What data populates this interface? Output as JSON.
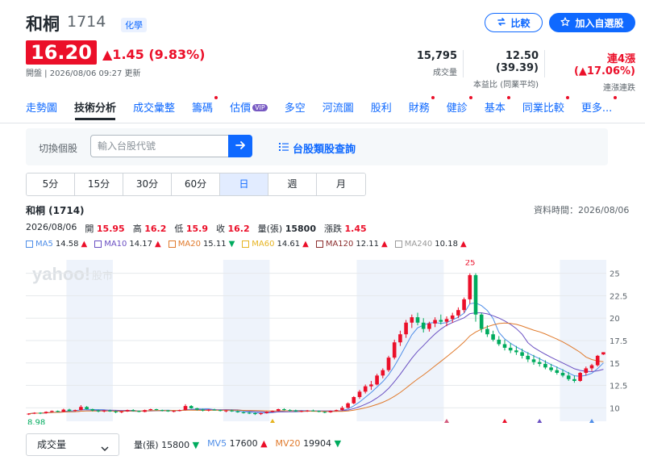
{
  "header": {
    "name": "和桐",
    "code": "1714",
    "sector": "化學",
    "compare_label": "比較",
    "watchlist_label": "加入自選股"
  },
  "quote": {
    "price": "16.20",
    "change": "▲1.45 (9.83%)",
    "market_time": "開盤 | 2026/08/06 09:27 更新"
  },
  "stats": [
    {
      "value": "15,795",
      "label": "成交量"
    },
    {
      "value": "12.50 (39.39)",
      "label": "本益比 (同業平均)"
    },
    {
      "value": "連4漲 (▲17.06%)",
      "label": "連漲連跌"
    }
  ],
  "tabs": [
    {
      "label": "走勢圖",
      "dot": false
    },
    {
      "label": "技術分析",
      "dot": false,
      "active": true
    },
    {
      "label": "成交彙整",
      "dot": false
    },
    {
      "label": "籌碼",
      "dot": true
    },
    {
      "label": "估價",
      "dot": false,
      "vip": "VIP"
    },
    {
      "label": "多空",
      "dot": false
    },
    {
      "label": "河流圖",
      "dot": false
    },
    {
      "label": "股利",
      "dot": false
    },
    {
      "label": "財務",
      "dot": true
    },
    {
      "label": "健診",
      "dot": true
    },
    {
      "label": "基本",
      "dot": true
    },
    {
      "label": "同業比較",
      "dot": true
    },
    {
      "label": "更多...",
      "dot": true
    }
  ],
  "switcher": {
    "label": "切換個股",
    "placeholder": "輸入台股代號",
    "category_link": "台股類股查詢"
  },
  "periods": [
    "5分",
    "15分",
    "30分",
    "60分",
    "日",
    "週",
    "月"
  ],
  "active_period": "日",
  "chart_header": {
    "title": "和桐 (1714)",
    "data_time": "資料時間：2026/08/06",
    "date": "2026/08/06",
    "open_label": "開",
    "open": "15.95",
    "high_label": "高",
    "high": "16.2",
    "low_label": "低",
    "low": "15.9",
    "close_label": "收",
    "close": "16.2",
    "vol_label": "量(張)",
    "vol": "15800",
    "chg_label": "漲跌",
    "chg": "1.45"
  },
  "ma_legend": [
    {
      "label": "MA5",
      "value": "14.58",
      "dir": "▲",
      "color": "#4f8ee8"
    },
    {
      "label": "MA10",
      "value": "14.17",
      "dir": "▲",
      "color": "#6a4fc2"
    },
    {
      "label": "MA20",
      "value": "15.11",
      "dir": "▼",
      "color": "#e07a2c"
    },
    {
      "label": "MA60",
      "value": "14.61",
      "dir": "▲",
      "color": "#e6b422"
    },
    {
      "label": "MA120",
      "value": "12.11",
      "dir": "▲",
      "color": "#8b2d2d"
    },
    {
      "label": "MA240",
      "value": "10.18",
      "dir": "▲",
      "color": "#9a9a9a"
    }
  ],
  "chart_data": {
    "type": "candlestick",
    "y_ticks": [
      "25",
      "22.5",
      "20",
      "17.5",
      "15",
      "12.5",
      "10"
    ],
    "ylim": [
      8.5,
      26.5
    ],
    "min_label": "8.98",
    "max_label": "25",
    "candles": [
      [
        9.3,
        9.4,
        9.2,
        9.35
      ],
      [
        9.35,
        9.5,
        9.3,
        9.45
      ],
      [
        9.45,
        9.5,
        9.3,
        9.4
      ],
      [
        9.4,
        9.6,
        9.35,
        9.55
      ],
      [
        9.55,
        9.7,
        9.5,
        9.65
      ],
      [
        9.65,
        9.7,
        9.5,
        9.55
      ],
      [
        9.55,
        9.9,
        9.5,
        9.8
      ],
      [
        9.8,
        9.9,
        9.6,
        9.65
      ],
      [
        9.65,
        9.8,
        9.6,
        9.75
      ],
      [
        9.75,
        10.3,
        9.7,
        10.1
      ],
      [
        10.1,
        10.2,
        9.8,
        9.85
      ],
      [
        9.85,
        9.9,
        9.6,
        9.7
      ],
      [
        9.7,
        9.8,
        9.5,
        9.6
      ],
      [
        9.6,
        9.75,
        9.5,
        9.7
      ],
      [
        9.7,
        9.8,
        9.55,
        9.6
      ],
      [
        9.6,
        9.7,
        9.4,
        9.5
      ],
      [
        9.5,
        9.65,
        9.4,
        9.6
      ],
      [
        9.6,
        9.8,
        9.55,
        9.75
      ],
      [
        9.75,
        9.85,
        9.6,
        9.65
      ],
      [
        9.65,
        9.7,
        9.5,
        9.55
      ],
      [
        9.55,
        9.8,
        9.5,
        9.75
      ],
      [
        9.75,
        9.9,
        9.7,
        9.85
      ],
      [
        9.85,
        9.9,
        9.7,
        9.75
      ],
      [
        9.75,
        9.8,
        9.6,
        9.7
      ],
      [
        9.7,
        9.75,
        9.55,
        9.6
      ],
      [
        9.6,
        9.7,
        9.5,
        9.65
      ],
      [
        9.65,
        9.8,
        9.6,
        9.75
      ],
      [
        9.75,
        10.4,
        9.7,
        10.2
      ],
      [
        10.2,
        10.3,
        9.9,
        9.95
      ],
      [
        9.95,
        10.0,
        9.7,
        9.8
      ],
      [
        9.8,
        9.9,
        9.6,
        9.7
      ],
      [
        9.7,
        9.85,
        9.6,
        9.8
      ],
      [
        9.8,
        9.9,
        9.7,
        9.75
      ],
      [
        9.75,
        9.8,
        9.6,
        9.65
      ],
      [
        9.65,
        9.75,
        9.5,
        9.7
      ],
      [
        9.7,
        9.8,
        9.55,
        9.6
      ],
      [
        9.6,
        9.7,
        9.45,
        9.5
      ],
      [
        9.5,
        9.6,
        9.35,
        9.45
      ],
      [
        9.45,
        9.55,
        9.3,
        9.4
      ],
      [
        9.4,
        9.5,
        9.2,
        9.3
      ],
      [
        9.3,
        9.45,
        9.2,
        9.4
      ],
      [
        9.4,
        9.6,
        9.35,
        9.55
      ],
      [
        9.55,
        9.7,
        9.5,
        9.65
      ],
      [
        9.65,
        9.9,
        9.6,
        9.85
      ],
      [
        9.85,
        9.95,
        9.7,
        9.75
      ],
      [
        9.75,
        9.85,
        9.6,
        9.7
      ],
      [
        9.7,
        9.8,
        9.55,
        9.6
      ],
      [
        9.6,
        9.7,
        9.5,
        9.65
      ],
      [
        9.65,
        9.75,
        9.55,
        9.7
      ],
      [
        9.7,
        9.8,
        9.6,
        9.65
      ],
      [
        9.65,
        9.7,
        9.5,
        9.55
      ],
      [
        9.55,
        9.6,
        9.4,
        9.5
      ],
      [
        9.5,
        9.7,
        9.45,
        9.65
      ],
      [
        9.65,
        9.8,
        9.6,
        9.75
      ],
      [
        9.75,
        10.2,
        9.7,
        10.0
      ],
      [
        10.0,
        10.6,
        9.95,
        10.5
      ],
      [
        10.5,
        11.3,
        10.4,
        11.2
      ],
      [
        11.2,
        12.0,
        11.0,
        11.8
      ],
      [
        11.8,
        12.6,
        11.6,
        12.4
      ],
      [
        12.4,
        13.0,
        12.0,
        12.6
      ],
      [
        12.6,
        13.8,
        12.5,
        13.6
      ],
      [
        13.6,
        14.4,
        13.3,
        14.2
      ],
      [
        14.2,
        15.8,
        14.0,
        15.6
      ],
      [
        15.6,
        17.6,
        15.4,
        17.3
      ],
      [
        17.3,
        18.6,
        16.9,
        18.2
      ],
      [
        18.2,
        19.8,
        17.8,
        19.5
      ],
      [
        19.5,
        20.4,
        18.9,
        20.1
      ],
      [
        20.1,
        20.6,
        19.2,
        19.5
      ],
      [
        19.5,
        20.0,
        18.4,
        18.8
      ],
      [
        18.8,
        19.6,
        18.5,
        19.4
      ],
      [
        19.4,
        20.1,
        19.0,
        19.8
      ],
      [
        19.8,
        20.4,
        19.3,
        19.6
      ],
      [
        19.6,
        20.2,
        19.1,
        19.9
      ],
      [
        19.9,
        20.6,
        19.5,
        20.3
      ],
      [
        20.3,
        21.2,
        20.0,
        20.9
      ],
      [
        20.9,
        22.3,
        20.6,
        22.1
      ],
      [
        22.1,
        25.0,
        21.6,
        24.8
      ],
      [
        24.8,
        25.0,
        19.6,
        20.4
      ],
      [
        20.4,
        20.6,
        18.4,
        18.8
      ],
      [
        18.8,
        19.2,
        17.9,
        18.2
      ],
      [
        18.2,
        18.6,
        17.4,
        17.6
      ],
      [
        17.6,
        18.0,
        16.9,
        17.1
      ],
      [
        17.1,
        17.6,
        16.4,
        16.7
      ],
      [
        16.7,
        17.2,
        16.1,
        16.4
      ],
      [
        16.4,
        16.9,
        15.9,
        16.2
      ],
      [
        16.2,
        16.6,
        15.5,
        15.8
      ],
      [
        15.8,
        16.2,
        15.1,
        15.4
      ],
      [
        15.4,
        15.9,
        14.8,
        15.1
      ],
      [
        15.1,
        15.6,
        14.6,
        14.9
      ],
      [
        14.9,
        15.3,
        14.3,
        14.5
      ],
      [
        14.5,
        14.9,
        14.0,
        14.2
      ],
      [
        14.2,
        14.6,
        13.7,
        13.9
      ],
      [
        13.9,
        14.3,
        13.4,
        13.6
      ],
      [
        13.6,
        14.0,
        13.0,
        13.2
      ],
      [
        13.2,
        13.6,
        12.8,
        13.0
      ],
      [
        13.0,
        14.0,
        12.9,
        13.9
      ],
      [
        13.9,
        14.6,
        13.6,
        14.4
      ],
      [
        14.4,
        14.9,
        14.1,
        14.75
      ],
      [
        14.75,
        15.9,
        14.6,
        15.8
      ],
      [
        15.95,
        16.2,
        15.9,
        16.2
      ]
    ],
    "highlight_bands": [
      [
        7,
        15
      ],
      [
        34,
        42
      ],
      [
        57,
        72
      ],
      [
        92,
        100
      ]
    ],
    "markers": [
      {
        "index": 42,
        "kind": "up",
        "color": "#e6b422"
      },
      {
        "index": 72,
        "kind": "up",
        "color": "#d35c7e"
      },
      {
        "index": 82,
        "kind": "up",
        "color": "#eb0f29"
      },
      {
        "index": 88,
        "kind": "up",
        "color": "#6a4fc2"
      },
      {
        "index": 97,
        "kind": "up",
        "color": "#4f8ee8"
      }
    ]
  },
  "volume_bar": {
    "select_label": "成交量",
    "vol_label": "量(張)",
    "vol": "15800",
    "vol_dir": "▼",
    "mv5_label": "MV5",
    "mv5": "17600",
    "mv5_dir": "▲",
    "mv20_label": "MV20",
    "mv20": "19904",
    "mv20_dir": "▼"
  },
  "colors": {
    "up": "#eb0f29",
    "down": "#00ab5e",
    "brand": "#0f69ff"
  }
}
